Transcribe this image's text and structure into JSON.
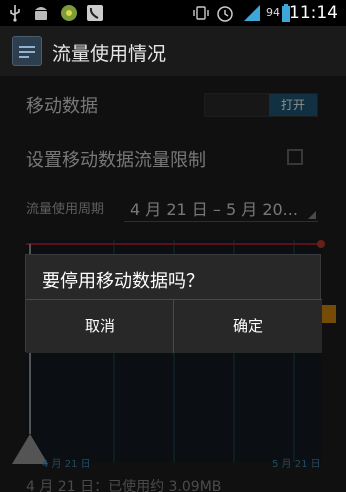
{
  "status_bar": {
    "time": "11:14",
    "battery_percent": "94",
    "icons": [
      "usb-icon",
      "android-icon",
      "app-notification-icon",
      "phone-notification-icon",
      "vibrate-icon",
      "alarm-icon",
      "signal-icon",
      "battery-icon"
    ]
  },
  "action_bar": {
    "title": "流量使用情况",
    "icon": "data-usage-app-icon"
  },
  "settings": {
    "mobile_data_label": "移动数据",
    "mobile_data_toggle": "打开",
    "set_limit_label": "设置移动数据流量限制",
    "set_limit_checked": false,
    "cycle_label": "流量使用周期",
    "cycle_value": "4 月 21 日 – 5 月 20..."
  },
  "chart": {
    "start_date": "4 月 21 日",
    "end_date": "5 月 21 日"
  },
  "footer": {
    "usage_text": "4 月 21 日：已使用约 3.09MB"
  },
  "dialog": {
    "title": "要停用移动数据吗？",
    "cancel_label": "取消",
    "confirm_label": "确定"
  },
  "colors": {
    "accent": "#1f5a78",
    "warning_line": "#b01d1d",
    "limit_handle": "#d68910"
  }
}
